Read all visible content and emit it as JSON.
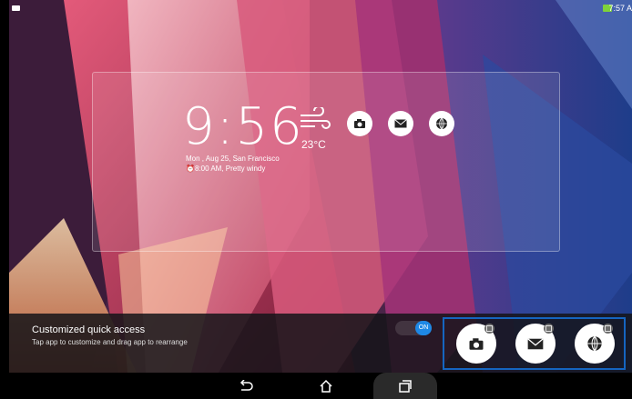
{
  "status_bar": {
    "time": "7:57 A",
    "left_icon": "notification-icon",
    "battery_icon": "battery-charging-icon",
    "battery_color": "#7fd23a"
  },
  "widget": {
    "clock": "9:56",
    "temperature": "23°C",
    "weather_icon": "wind-icon",
    "date_location": "Mon , Aug 25, San Francisco",
    "alarm_weather": "8:00 AM, Pretty windy",
    "quick_icons": [
      "camera-icon",
      "mail-icon",
      "globe-icon"
    ]
  },
  "panel": {
    "title": "Customized quick access",
    "subtitle": "Tap app to customize and drag app to rearrange",
    "toggle_label": "ON",
    "toggle_color": "#1e88e5",
    "apps": [
      "camera-icon",
      "mail-icon",
      "globe-icon"
    ],
    "highlight_color": "#1565c0"
  },
  "navbar": {
    "buttons": [
      "back-icon",
      "home-icon",
      "recent-apps-icon"
    ]
  }
}
